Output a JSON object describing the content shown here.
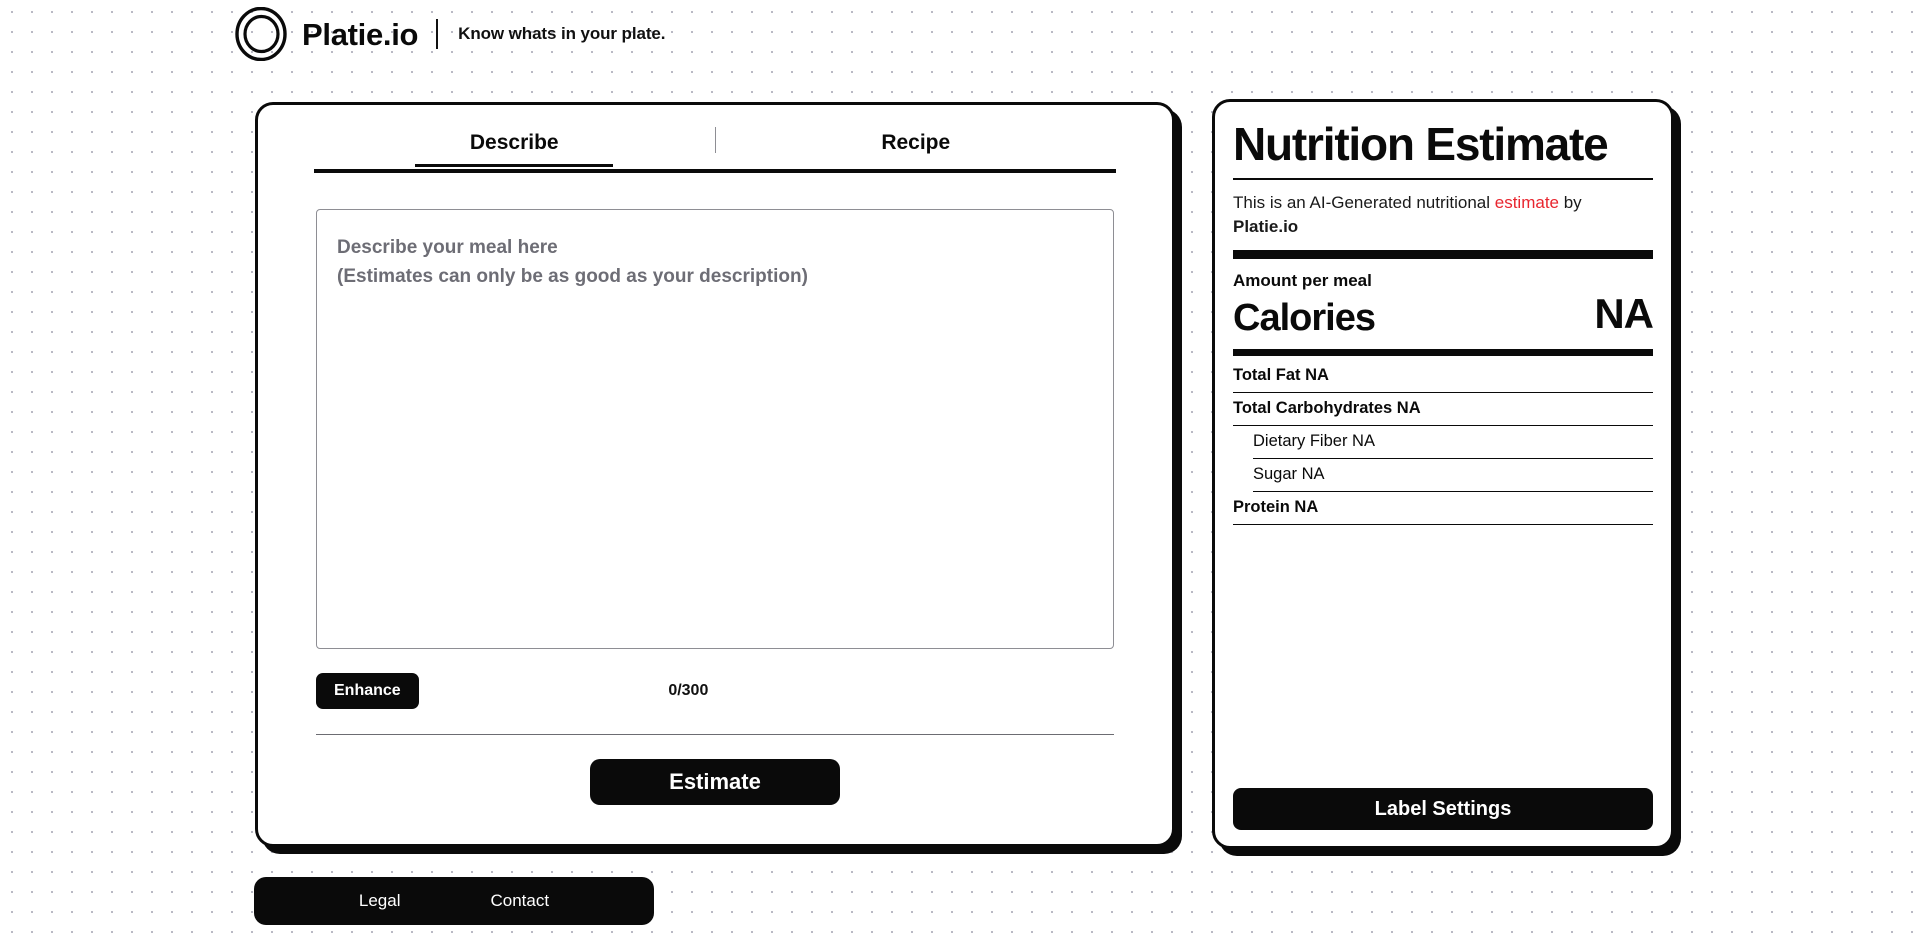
{
  "header": {
    "logo_icon": "circle-plate-logo-icon",
    "brand": "Platie.io",
    "tagline": "Know whats in your plate."
  },
  "main": {
    "tabs": [
      {
        "label": "Describe",
        "active": true
      },
      {
        "label": "Recipe",
        "active": false
      }
    ],
    "textarea": {
      "value": "",
      "placeholder": "Describe your meal here\n(Estimates can only be as good as your description)"
    },
    "enhance_label": "Enhance",
    "char_count": "0/300",
    "estimate_label": "Estimate"
  },
  "nutrition_label": {
    "title": "Nutrition Estimate",
    "disclaimer_prefix": "This is an AI-Generated nutritional ",
    "disclaimer_highlight": "estimate",
    "disclaimer_suffix": " by",
    "disclaimer_brand": "Platie.io",
    "amount_per_meal": "Amount per meal",
    "calories_label": "Calories",
    "calories_value": "NA",
    "rows": [
      {
        "text": "Total Fat NA",
        "bold": true,
        "indent": false
      },
      {
        "text": "Total Carbohydrates NA",
        "bold": true,
        "indent": false
      },
      {
        "text": "Dietary Fiber NA",
        "bold": false,
        "indent": true
      },
      {
        "text": "Sugar NA",
        "bold": false,
        "indent": true
      },
      {
        "text": "Protein NA",
        "bold": true,
        "indent": false
      }
    ],
    "settings_label": "Label Settings"
  },
  "footer": {
    "links": [
      {
        "label": "Legal"
      },
      {
        "label": "Contact"
      }
    ]
  },
  "colors": {
    "accent_red": "#e8262f",
    "ink": "#0a0a0a",
    "muted": "#6d6d75",
    "dot_grid": "#b9b9c4"
  }
}
